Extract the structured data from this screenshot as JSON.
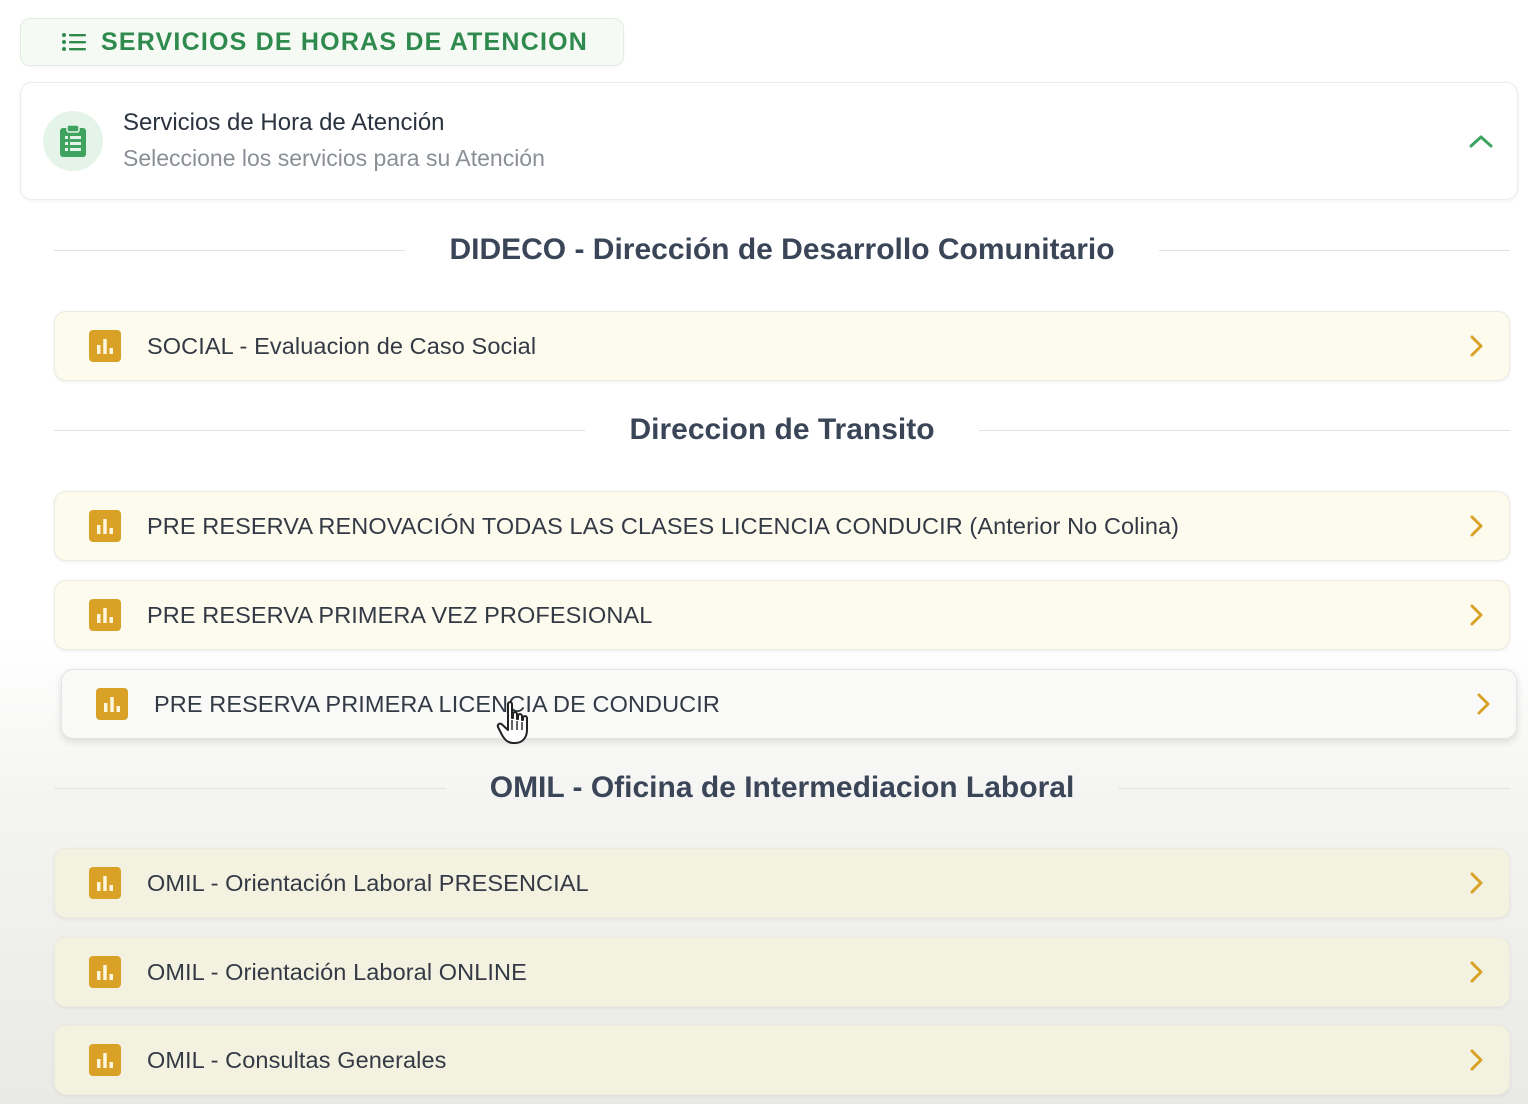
{
  "section": {
    "title": "SERVICIOS DE HORAS DE ATENCION"
  },
  "header_card": {
    "title": "Servicios de Hora de Atención",
    "subtitle": "Seleccione los servicios para su Atención"
  },
  "groups": [
    {
      "title": "DIDECO - Dirección de Desarrollo Comunitario",
      "services": [
        {
          "label": "SOCIAL - Evaluacion de Caso Social"
        }
      ]
    },
    {
      "title": "Direccion de Transito",
      "services": [
        {
          "label": "PRE RESERVA RENOVACIÓN TODAS LAS CLASES LICENCIA CONDUCIR (Anterior No Colina)"
        },
        {
          "label": "PRE RESERVA PRIMERA VEZ PROFESIONAL"
        },
        {
          "label": "PRE RESERVA PRIMERA LICENCIA DE CONDUCIR"
        }
      ]
    },
    {
      "title": "OMIL - Oficina de Intermediacion Laboral",
      "services": [
        {
          "label": "OMIL - Orientación Laboral PRESENCIAL"
        },
        {
          "label": "OMIL - Orientación Laboral ONLINE"
        },
        {
          "label": "OMIL - Consultas Generales"
        }
      ]
    }
  ],
  "colors": {
    "accent_green": "#2f8a4e",
    "icon_gold": "#d9a227",
    "row_background": "#fdfbee"
  },
  "icons": {
    "section": "list-icon",
    "header_badge": "clipboard-icon",
    "collapse": "chevron-up-icon",
    "service": "bar-chart-icon",
    "row_action": "chevron-right-icon"
  }
}
